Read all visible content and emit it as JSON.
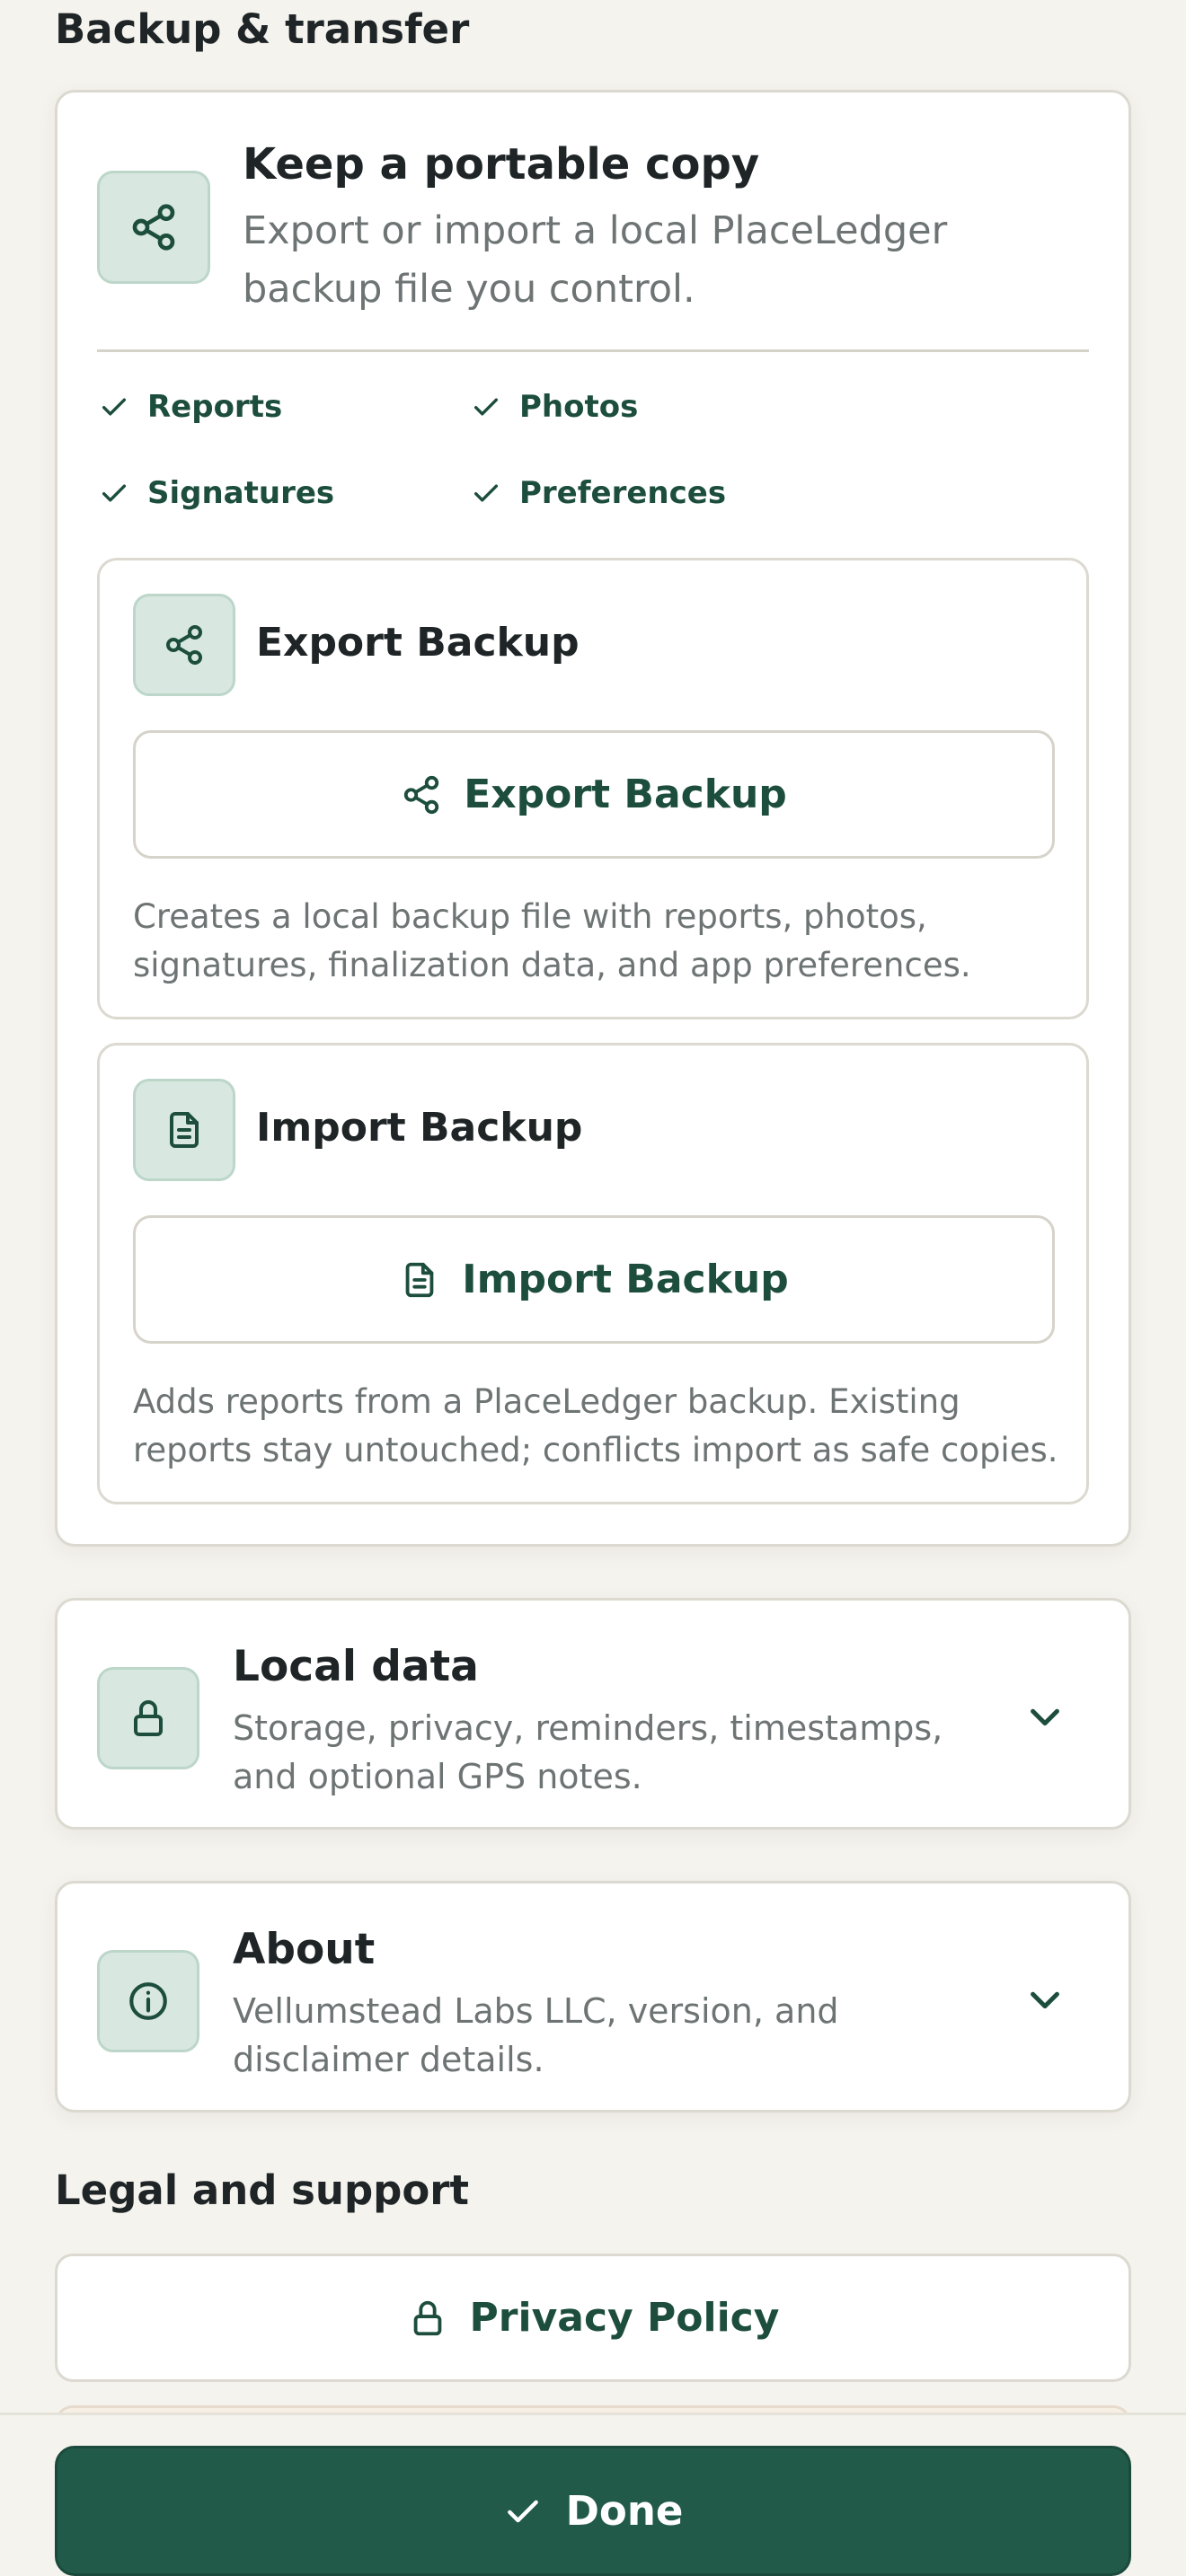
{
  "backup_section": {
    "title": "Backup & transfer",
    "hero": {
      "icon": "share-icon",
      "title": "Keep a portable copy",
      "subtitle": "Export or import a local PlaceLedger backup file you control."
    },
    "included": [
      "Reports",
      "Photos",
      "Signatures",
      "Preferences"
    ],
    "export": {
      "icon": "share-icon",
      "title": "Export Backup",
      "button_label": "Export Backup",
      "description": "Creates a local backup file with reports, photos, signatures, finalization data, and app preferences."
    },
    "import": {
      "icon": "document-icon",
      "title": "Import Backup",
      "button_label": "Import Backup",
      "description": "Adds reports from a PlaceLedger backup. Existing reports stay untouched; conflicts import as safe copies."
    }
  },
  "local_data": {
    "icon": "lock-icon",
    "title": "Local data",
    "subtitle": "Storage, privacy, reminders, timestamps, and optional GPS notes."
  },
  "about": {
    "icon": "info-icon",
    "title": "About",
    "subtitle": "Vellumstead Labs LLC, version, and disclaimer details."
  },
  "legal_section": {
    "title": "Legal and support",
    "privacy_label": "Privacy Policy",
    "privacy_icon": "lock-icon"
  },
  "footer": {
    "done_label": "Done",
    "done_icon": "check-icon"
  },
  "colors": {
    "accent": "#1c4d3d",
    "done_button": "#225a49",
    "background": "#f5f3ee",
    "icon_tile": "#d8e8e0"
  }
}
